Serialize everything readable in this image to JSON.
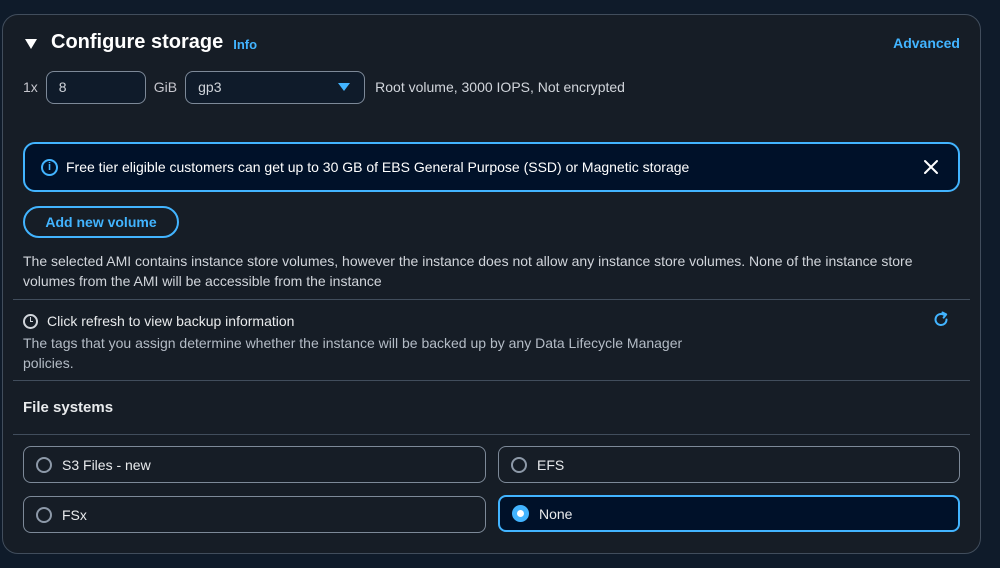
{
  "section": {
    "title": "Configure storage",
    "info_label": "Info",
    "advanced_label": "Advanced"
  },
  "volume": {
    "count_label": "1x",
    "size_value": "8",
    "unit_label": "GiB",
    "type_value": "gp3",
    "description": "Root volume,  3000 IOPS,  Not encrypted"
  },
  "alert": {
    "text": "Free tier eligible customers can get up to 30 GB of EBS General Purpose (SSD) or Magnetic storage"
  },
  "add_volume_label": "Add new volume",
  "ami_notice": "The selected AMI contains instance store volumes, however the instance does not allow any instance store volumes. None of the instance store volumes from the AMI will be accessible from the instance",
  "backup": {
    "title": "Click refresh to view backup information",
    "description": "The tags that you assign determine whether the instance will be backed up by any Data Lifecycle Manager policies."
  },
  "file_systems": {
    "title": "File systems",
    "options": [
      {
        "label": "S3 Files - new",
        "selected": false
      },
      {
        "label": "EFS",
        "selected": false
      },
      {
        "label": "FSx",
        "selected": false
      },
      {
        "label": "None",
        "selected": true
      }
    ]
  },
  "colors": {
    "accent": "#42b4ff",
    "panel_bg": "#161d26",
    "page_bg": "#0f1b2a",
    "border": "#414d5c"
  },
  "icons": [
    "caret-down-icon",
    "info-icon",
    "close-icon",
    "clock-icon",
    "refresh-icon",
    "dropdown-caret-icon"
  ]
}
